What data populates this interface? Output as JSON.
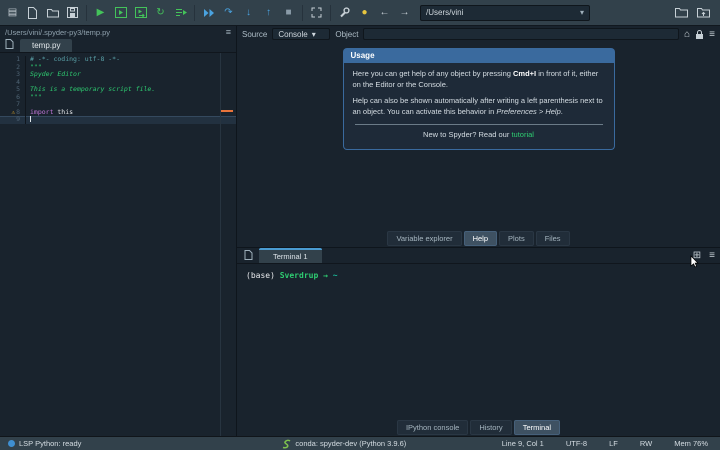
{
  "colors": {
    "bg": "#19232D",
    "panel": "#32414B",
    "accent_blue": "#3A6A9E",
    "tab_accent": "#4A9BD1",
    "green": "#2ecc71",
    "run_green": "#44c35a",
    "debug_blue": "#4aa3e0",
    "warning_yellow": "#f0b429",
    "marker_orange": "#e8743b"
  },
  "icons": {
    "main_menu": "▤",
    "hamburger": "≡",
    "run": "▶",
    "rerun": "↻",
    "step": "↷",
    "step_into": "↓",
    "step_out": "↑",
    "stop": "■",
    "python_env": "●",
    "back": "←",
    "forward": "→",
    "caret_down": "▾",
    "home": "⌂",
    "new_terminal": "⊞",
    "warning": "⚠",
    "new_file": "svg:page",
    "save": "svg:floppy",
    "open_folder": "svg:folder",
    "parent_folder": "svg:folder-up",
    "lock": "svg:lock",
    "maximize": "svg:expand",
    "preferences": "svg:wrench",
    "debug_continue": "svg:double-play",
    "run_cell": "svg:boxed-play",
    "run_cell_advance": "svg:boxed-play-arrow",
    "run_selection": "svg:lines-play",
    "conda": "svg:snake"
  },
  "toolbar": {
    "path_value": "/Users/vini"
  },
  "editor": {
    "path": "/Users/vini/.spyder-py3/temp.py",
    "tab": "temp.py",
    "line_numbers": [
      "1",
      "2",
      "3",
      "4",
      "5",
      "6",
      "7",
      "8",
      "9"
    ],
    "code": {
      "l1": "# -*- coding: utf-8 -*-",
      "l2": "\"\"\"",
      "l3": "Spyder Editor",
      "l5": "This is a temporary script file.",
      "l6": "\"\"\"",
      "l8_kw": "import",
      "l8_rest": " this"
    }
  },
  "help": {
    "source_label": "Source",
    "source_value": "Console",
    "object_label": "Object",
    "usage": {
      "title": "Usage",
      "p1_pre": "Here you can get help of any object by pressing ",
      "p1_kbd": "Cmd+I",
      "p1_post": " in front of it, either on the Editor or the Console.",
      "p2_pre": "Help can also be shown automatically after writing a left parenthesis next to an object. You can activate this behavior in ",
      "p2_em": "Preferences > Help",
      "p2_post": ".",
      "footer_pre": "New to Spyder? Read our ",
      "footer_link": "tutorial"
    },
    "tabs": [
      {
        "label": "Variable explorer",
        "active": false
      },
      {
        "label": "Help",
        "active": true
      },
      {
        "label": "Plots",
        "active": false
      },
      {
        "label": "Files",
        "active": false
      }
    ]
  },
  "terminal": {
    "tab": "Terminal 1",
    "prompt": {
      "env": "(base)",
      "host": "Sverdrup",
      "arrow": "→",
      "path": "~"
    },
    "tabs": [
      {
        "label": "IPython console",
        "active": false
      },
      {
        "label": "History",
        "active": false
      },
      {
        "label": "Terminal",
        "active": true
      }
    ]
  },
  "statusbar": {
    "lsp": "LSP Python: ready",
    "conda": "conda: spyder-dev (Python 3.9.6)",
    "cursor": "Line 9, Col 1",
    "encoding": "UTF-8",
    "eol": "LF",
    "permissions": "RW",
    "memory": "Mem 76%"
  }
}
